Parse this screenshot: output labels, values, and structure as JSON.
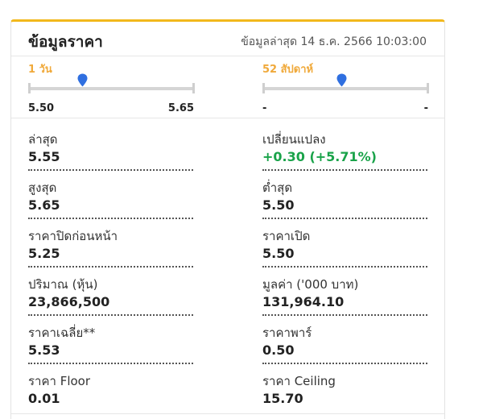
{
  "header": {
    "title": "ข้อมูลราคา",
    "updated": "ข้อมูลล่าสุด 14 ธ.ค. 2566 10:03:00"
  },
  "ranges": {
    "day": {
      "label": "1 วัน",
      "low": "5.50",
      "high": "5.65",
      "marker_fraction": 0.33
    },
    "week52": {
      "label": "52 สัปดาห์",
      "low": "-",
      "high": "-",
      "marker_fraction": 0.48
    }
  },
  "colors": {
    "accent": "#f2b81c",
    "range_label": "#f0a93a",
    "marker": "#2f6fe0",
    "positive": "#1aa34a"
  },
  "stats": [
    {
      "label": "ล่าสุด",
      "value": "5.55"
    },
    {
      "label": "เปลี่ยนแปลง",
      "value": "+0.30 (+5.71%)"
    },
    {
      "label": "สูงสุด",
      "value": "5.65"
    },
    {
      "label": "ต่ำสุด",
      "value": "5.50"
    },
    {
      "label": "ราคาปิดก่อนหน้า",
      "value": "5.25"
    },
    {
      "label": "ราคาเปิด",
      "value": "5.50"
    },
    {
      "label": "ปริมาณ (หุ้น)",
      "value": "23,866,500"
    },
    {
      "label": "มูลค่า ('000 บาท)",
      "value": "131,964.10"
    },
    {
      "label": "ราคาเฉลี่ย**",
      "value": "5.53"
    },
    {
      "label": "ราคาพาร์",
      "value": "0.50"
    },
    {
      "label": "ราคา Floor",
      "value": "0.01"
    },
    {
      "label": "ราคา Ceiling",
      "value": "15.70"
    }
  ]
}
